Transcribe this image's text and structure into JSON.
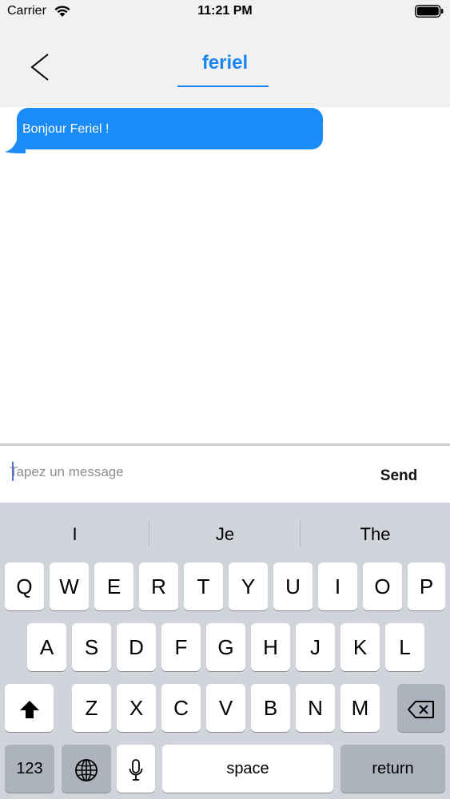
{
  "status_bar": {
    "carrier": "Carrier",
    "time": "11:21 PM"
  },
  "nav": {
    "title": "feriel"
  },
  "messages": [
    {
      "text": "Bonjour Feriel !"
    }
  ],
  "composer": {
    "placeholder": "Tapez un message",
    "value": "",
    "send_label": "Send"
  },
  "keyboard": {
    "suggestions": [
      "I",
      "Je",
      "The"
    ],
    "row1": [
      "Q",
      "W",
      "E",
      "R",
      "T",
      "Y",
      "U",
      "I",
      "O",
      "P"
    ],
    "row2": [
      "A",
      "S",
      "D",
      "F",
      "G",
      "H",
      "J",
      "K",
      "L"
    ],
    "row3": [
      "Z",
      "X",
      "C",
      "V",
      "B",
      "N",
      "M"
    ],
    "numbers_label": "123",
    "space_label": "space",
    "return_label": "return"
  },
  "colors": {
    "accent": "#1a86f3",
    "bubble": "#1a8bf7",
    "keyboard_bg": "#d1d4db"
  }
}
